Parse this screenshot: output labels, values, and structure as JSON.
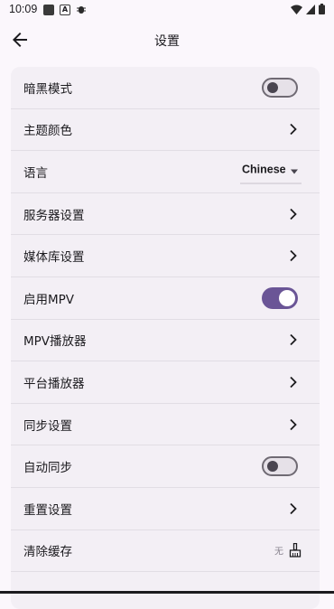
{
  "status_bar": {
    "time": "10:09",
    "left_icons": [
      "square-notification-icon",
      "a-notification-icon",
      "bug-icon"
    ],
    "right_icons": [
      "wifi-icon",
      "signal-icon",
      "battery-icon"
    ]
  },
  "app_bar": {
    "title": "设置",
    "back_icon": "arrow-back-icon"
  },
  "settings": {
    "dark_mode": {
      "label": "暗黑模式",
      "enabled": false
    },
    "theme_color": {
      "label": "主题颜色"
    },
    "language": {
      "label": "语言",
      "value": "Chinese"
    },
    "server_settings": {
      "label": "服务器设置"
    },
    "library_settings": {
      "label": "媒体库设置"
    },
    "enable_mpv": {
      "label": "启用MPV",
      "enabled": true
    },
    "mpv_player": {
      "label": "MPV播放器"
    },
    "platform_player": {
      "label": "平台播放器"
    },
    "sync_settings": {
      "label": "同步设置"
    },
    "auto_sync": {
      "label": "自动同步",
      "enabled": false
    },
    "reset_settings": {
      "label": "重置设置"
    },
    "clear_cache": {
      "label": "清除缓存",
      "value": "无",
      "icon": "broom-icon"
    }
  },
  "colors": {
    "accent": "#6a5596",
    "background": "#fbf7fc",
    "card": "#f3eff5"
  }
}
